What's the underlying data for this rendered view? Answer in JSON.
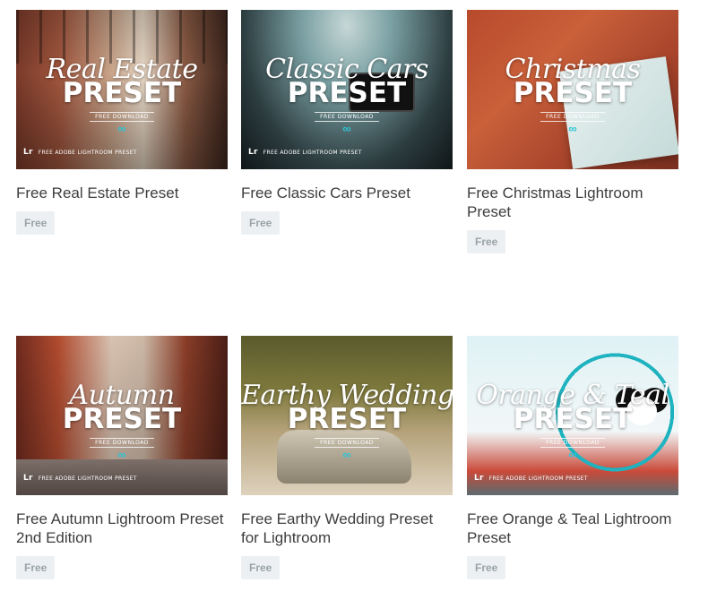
{
  "badge_label": "Free",
  "overlay": {
    "free_download": "FREE DOWNLOAD",
    "lr": "Lr",
    "lightroom_note": "FREE ADOBE LIGHTROOM PRESET"
  },
  "cards": [
    {
      "title": "Free Real Estate Preset",
      "script": "Real Estate",
      "preset": "PRESET"
    },
    {
      "title": "Free Classic Cars Preset",
      "script": "Classic Cars",
      "preset": "PRESET"
    },
    {
      "title": "Free Christmas Lightroom Preset",
      "script": "Christmas",
      "preset": "PRESET"
    },
    {
      "title": "Free Autumn Lightroom Preset 2nd Edition",
      "script": "Autumn",
      "preset": "PRESET"
    },
    {
      "title": "Free Earthy Wedding Preset for Lightroom",
      "script": "Earthy Wedding",
      "preset": "PRESET"
    },
    {
      "title": "Free Orange & Teal Lightroom Preset",
      "script": "Orange & Teal",
      "preset": "PRESET"
    }
  ]
}
